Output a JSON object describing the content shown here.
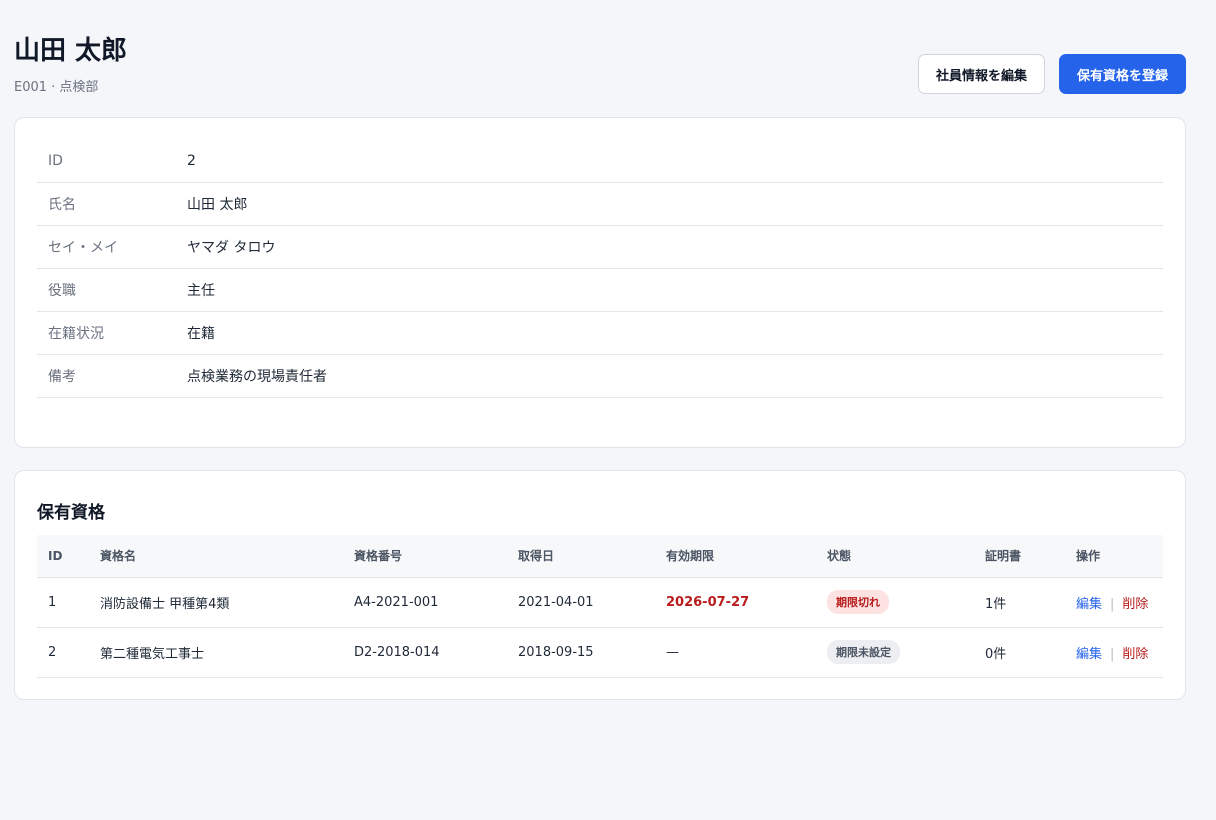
{
  "header": {
    "title": "山田 太郎",
    "subtitle": "E001 · 点検部",
    "edit_button": "社員情報を編集",
    "register_button": "保有資格を登録"
  },
  "info": [
    {
      "label": "ID",
      "value": "2"
    },
    {
      "label": "氏名",
      "value": "山田 太郎"
    },
    {
      "label": "セイ・メイ",
      "value": "ヤマダ タロウ"
    },
    {
      "label": "役職",
      "value": "主任"
    },
    {
      "label": "在籍状況",
      "value": "在籍"
    },
    {
      "label": "備考",
      "value": "点検業務の現場責任者"
    }
  ],
  "qualifications": {
    "title": "保有資格",
    "columns": [
      "ID",
      "資格名",
      "資格番号",
      "取得日",
      "有効期限",
      "状態",
      "証明書",
      "操作"
    ],
    "rows": [
      {
        "id": "1",
        "name": "消防設備士 甲種第4類",
        "number": "A4-2021-001",
        "acquired": "2021-04-01",
        "expiry": "2026-07-27",
        "status": "期限切れ",
        "certificates": "1件",
        "edit": "編集",
        "delete": "削除"
      },
      {
        "id": "2",
        "name": "第二種電気工事士",
        "number": "D2-2018-014",
        "acquired": "2018-09-15",
        "expiry": "—",
        "status": "期限未設定",
        "certificates": "0件",
        "edit": "編集",
        "delete": "削除"
      }
    ],
    "separator": "|"
  },
  "colors": {
    "primary": "#2563eb",
    "danger": "#b91c1c",
    "danger_bg": "#fde2e2",
    "neutral_bg": "#eceef1"
  }
}
